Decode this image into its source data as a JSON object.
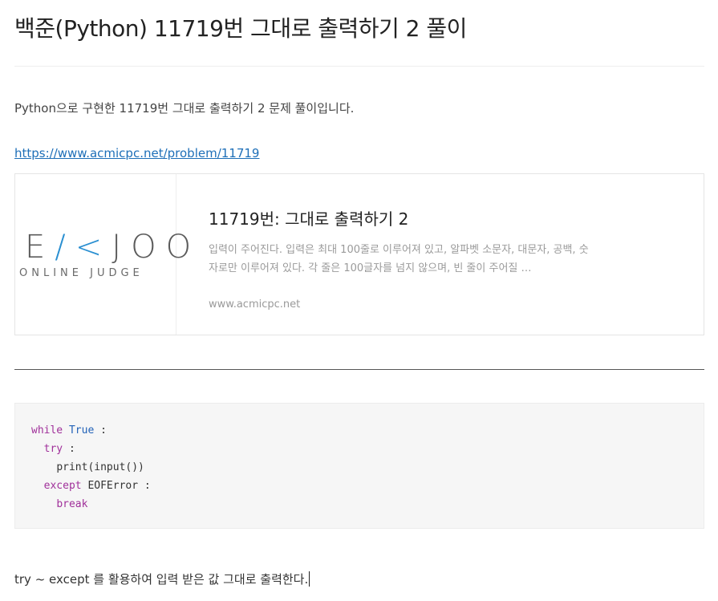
{
  "post": {
    "title": "백준(Python) 11719번 그대로 출력하기 2 풀이",
    "intro": "Python으로 구현한 11719번 그대로 출력하기 2 문제 풀이입니다.",
    "link": "https://www.acmicpc.net/problem/11719"
  },
  "og_card": {
    "logo_main_left": "E",
    "logo_main_accent": "/<",
    "logo_main_right": "JOO",
    "logo_sub": "ONLINE JUDGE",
    "title": "11719번: 그대로 출력하기 2",
    "description": "입력이 주어진다. 입력은 최대 100줄로 이루어져 있고, 알파벳 소문자, 대문자, 공백, 숫자로만 이루어져 있다. 각 줄은 100글자를 넘지 않으며, 빈 줄이 주어질 …",
    "host": "www.acmicpc.net"
  },
  "code": {
    "l1_kw": "while",
    "l1_const": "True",
    "l1_rest": " :",
    "l2_kw": "try",
    "l2_rest": " :",
    "l3": "print(input())",
    "l4_kw": "except",
    "l4_rest": " EOFError :",
    "l5_kw": "break"
  },
  "outro": "try ~ except 를 활용하여 입력 받은 값 그대로 출력한다."
}
